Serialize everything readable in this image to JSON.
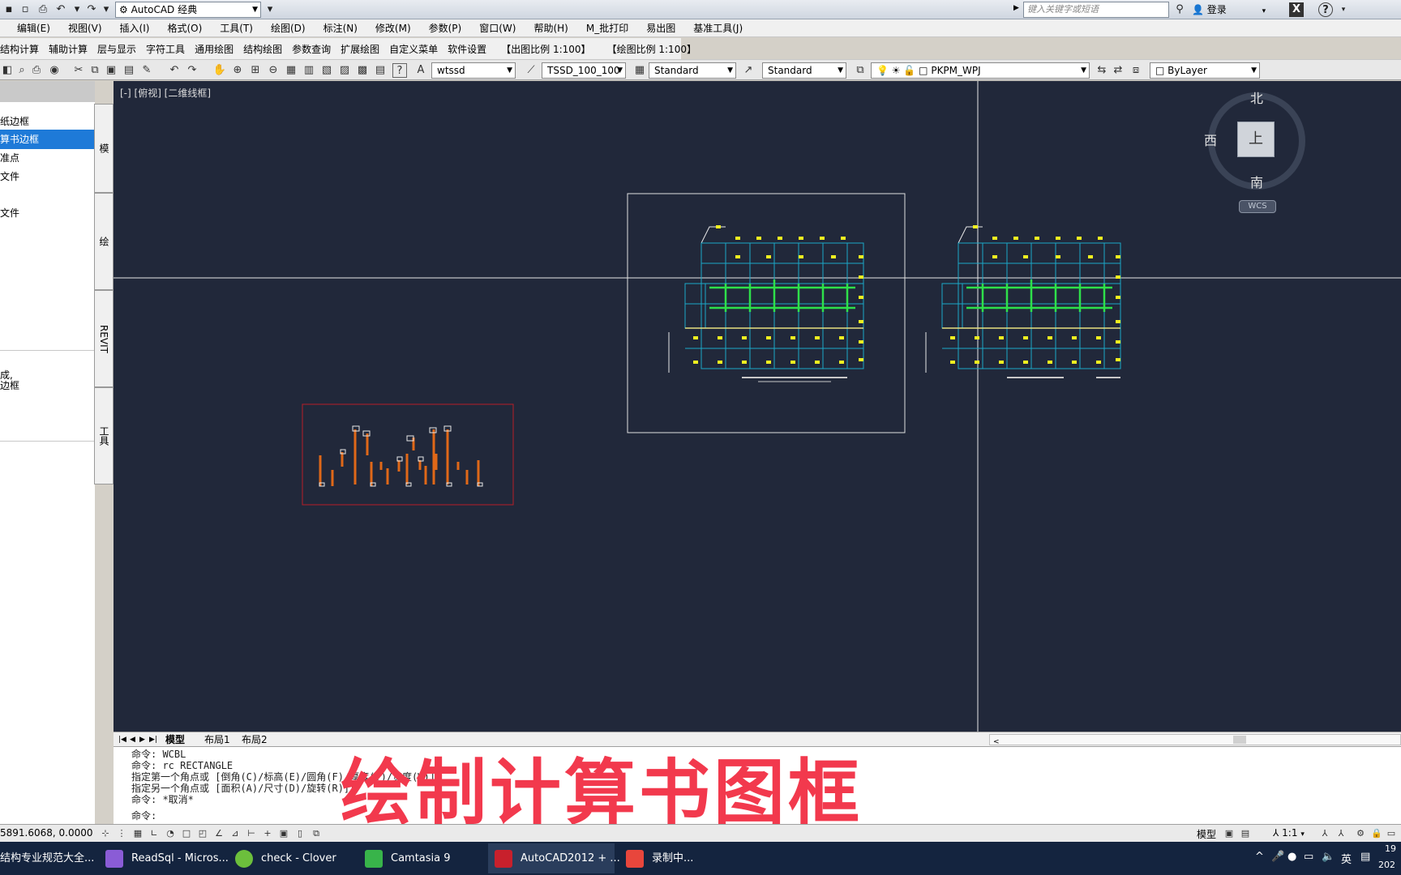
{
  "titlebar": {
    "workspace": "AutoCAD 经典",
    "search_placeholder": "键入关键字或短语",
    "login": "登录"
  },
  "menubar": [
    "编辑(E)",
    "视图(V)",
    "插入(I)",
    "格式(O)",
    "工具(T)",
    "绘图(D)",
    "标注(N)",
    "修改(M)",
    "参数(P)",
    "窗口(W)",
    "帮助(H)",
    "M_批打印",
    "易出图",
    "基准工具(J)"
  ],
  "menubar2": [
    "结构计算",
    "辅助计算",
    "层与显示",
    "字符工具",
    "通用绘图",
    "结构绘图",
    "参数查询",
    "扩展绘图",
    "自定义菜单",
    "软件设置",
    "【出图比例 1:100】",
    "【绘图比例 1:100】"
  ],
  "toolbar": {
    "text_style": "wtssd",
    "dim_style": "TSSD_100_100",
    "table_style": "Standard",
    "multileader_style": "Standard",
    "layer": "PKPM_WPJ",
    "color": "ByLayer"
  },
  "palette": {
    "items": [
      "纸边框",
      "算书边框",
      "准点",
      "文件",
      "文件",
      "成,",
      "边框"
    ],
    "selected_index": 1,
    "tabs": [
      "模",
      "绘",
      "REVIT",
      "工具"
    ]
  },
  "canvas": {
    "viewport_label": "[-] [俯视] [二维线框]",
    "viewcube": {
      "north": "北",
      "south": "南",
      "west": "西",
      "top": "上",
      "wcs": "WCS"
    }
  },
  "layout_tabs": [
    "模型",
    "布局1",
    "布局2"
  ],
  "command_history": [
    "命令: WCBL",
    "命令: rc RECTANGLE",
    "指定第一个角点或 [倒角(C)/标高(E)/圆角(F)/厚度(T)/宽度(W)]:",
    "指定另一个角点或 [面积(A)/尺寸(D)/旋转(R)]:",
    "命令: *取消*",
    "命令:"
  ],
  "overlay_title": "绘制计算书图框",
  "statusbar": {
    "coords": "5891.6068, 0.0000",
    "model_label": "模型",
    "scale": "1:1"
  },
  "taskbar": [
    {
      "label": "结构专业规范大全...",
      "color": "#d8d8d8"
    },
    {
      "label": "ReadSql - Micros...",
      "color": "#8a5cd6"
    },
    {
      "label": "check - Clover",
      "color": "#6cbf3c"
    },
    {
      "label": "Camtasia 9",
      "color": "#38b44a"
    },
    {
      "label": "AutoCAD2012 + ...",
      "color": "#c8202c"
    },
    {
      "label": "录制中...",
      "color": "#e8463c"
    }
  ],
  "tray": {
    "ime": "英",
    "time_top": "19",
    "time_bottom": "202"
  }
}
